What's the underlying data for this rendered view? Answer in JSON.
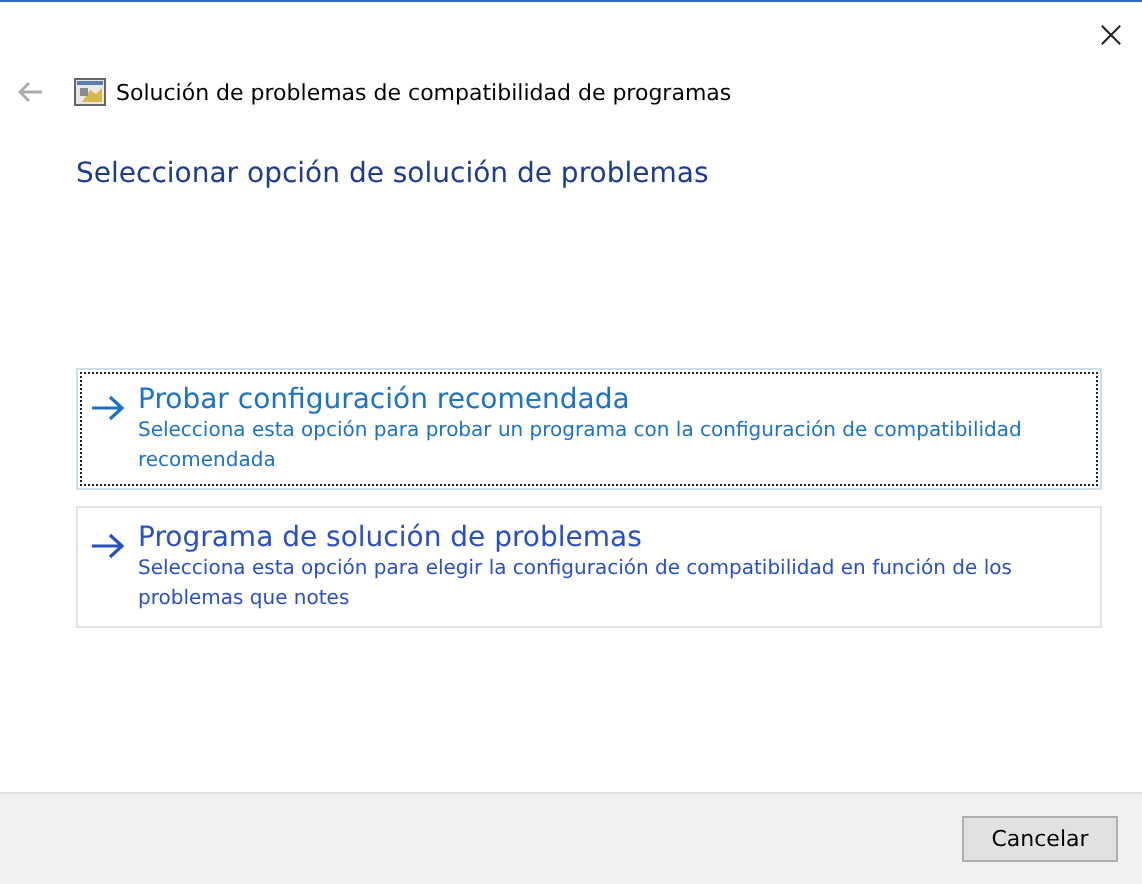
{
  "window": {
    "title": "Solución de problemas de compatibilidad de programas"
  },
  "heading": "Seleccionar opción de solución de problemas",
  "options": [
    {
      "title": "Probar configuración recomendada",
      "description": "Selecciona esta opción para probar un programa con la configuración de compatibilidad recomendada",
      "selected": true
    },
    {
      "title": "Programa de solución de problemas",
      "description": "Selecciona esta opción para elegir la configuración de compatibilidad en función de los problemas que notes",
      "selected": false
    }
  ],
  "buttons": [
    "Cancelar"
  ]
}
